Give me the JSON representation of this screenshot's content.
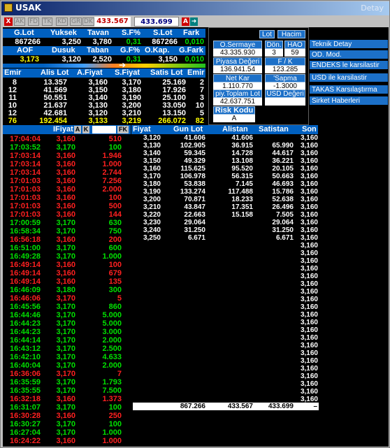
{
  "window": {
    "title": "USAK",
    "right_label": "Detay"
  },
  "toolbar": {
    "close": "X",
    "buttons": [
      "AK",
      "FD",
      "TK",
      "KD",
      "GR",
      "DK"
    ],
    "price_sell": "433.567",
    "price_buy": "433.699",
    "a_label": "A",
    "arrow": "➜"
  },
  "summary": {
    "headers1": [
      "G.Lot",
      "Yuksek",
      "Tavan",
      "S.F%",
      "S.Lot",
      "Fark"
    ],
    "values1": [
      "867266",
      "3,250",
      "3,780",
      "0,31",
      "867266",
      "0,010"
    ],
    "headers2": [
      "AOF",
      "Dusuk",
      "Taban",
      "G.F%",
      "O.Kap.",
      "G.Fark"
    ],
    "values2": [
      "3,173",
      "3,120",
      "2,520",
      "0,31",
      "3,150",
      "0,010"
    ]
  },
  "depth": {
    "headers": [
      "Emir",
      "Alis Lot",
      "A.Fiyat",
      "S.Fiyat",
      "Satis Lot",
      "Emir"
    ],
    "rows": [
      [
        "8",
        "13.357",
        "3,160",
        "3,170",
        "25.169",
        "2"
      ],
      [
        "12",
        "41.569",
        "3,150",
        "3,180",
        "17.926",
        "7"
      ],
      [
        "11",
        "50.551",
        "3,140",
        "3,190",
        "25.100",
        "3"
      ],
      [
        "10",
        "21.637",
        "3,130",
        "3,200",
        "33.050",
        "10"
      ],
      [
        "12",
        "42.681",
        "3,120",
        "3,210",
        "13.150",
        "5"
      ]
    ],
    "totals": [
      "76",
      "192.454",
      "3,133",
      "3,219",
      "266.072",
      "82"
    ]
  },
  "info_panel": {
    "lot_button": "Lot",
    "hacim_button": "Hacim",
    "o_sermaye_label": "O.Sermaye",
    "o_sermaye_value": "43.335.930",
    "don_label": "Dön.",
    "don_value": "3",
    "hao_label": "HAO",
    "hao_value": "59",
    "piyasa_label": "Piyasa Değeri",
    "piyasa_value": "136.941.54",
    "fk_label": "F / K",
    "fk_value": "123.285",
    "net_kar_label": "Net Kar",
    "net_kar_value": "1.110.770",
    "sapma_label": "'Sapma",
    "sapma_value": "-1.3000",
    "piy_toplam_label": "piy.Toplam Lot",
    "piy_toplam_value": "42.637.751",
    "usd_label": "USD Değeri",
    "usd_value": "",
    "risk_label": "Risk Kodu",
    "risk_value": "A"
  },
  "right_menu": [
    "Teknik Detay",
    "OD. Mod.",
    "ENDEKS le karsilastir",
    "USD ile karsilastir",
    "TAKAS Karsılaştırma",
    "Sirket Haberleri"
  ],
  "trades": {
    "headers": {
      "fiyat": "IFiyat",
      "a": "A",
      "k": "K",
      "fk": "FK"
    },
    "rows": [
      [
        "17:04:04",
        "3,160",
        "510",
        "r"
      ],
      [
        "17:03:52",
        "3,170",
        "100",
        "g"
      ],
      [
        "17:03:14",
        "3,160",
        "1.946",
        "r"
      ],
      [
        "17:03:14",
        "3,160",
        "1.000",
        "r"
      ],
      [
        "17:03:14",
        "3,160",
        "2.744",
        "r"
      ],
      [
        "17:01:03",
        "3,160",
        "7.256",
        "r"
      ],
      [
        "17:01:03",
        "3,160",
        "2.000",
        "r"
      ],
      [
        "17:01:03",
        "3,160",
        "100",
        "r"
      ],
      [
        "17:01:03",
        "3,160",
        "500",
        "r"
      ],
      [
        "17:01:03",
        "3,160",
        "144",
        "r"
      ],
      [
        "17:00:59",
        "3,170",
        "630",
        "g"
      ],
      [
        "16:58:34",
        "3,170",
        "750",
        "g"
      ],
      [
        "16:56:18",
        "3,160",
        "200",
        "r"
      ],
      [
        "16:51:00",
        "3,170",
        "600",
        "g"
      ],
      [
        "16:49:28",
        "3,170",
        "1.000",
        "g"
      ],
      [
        "16:49:14",
        "3,160",
        "100",
        "r"
      ],
      [
        "16:49:14",
        "3,160",
        "679",
        "r"
      ],
      [
        "16:49:14",
        "3,160",
        "135",
        "r"
      ],
      [
        "16:46:09",
        "3,180",
        "300",
        "g"
      ],
      [
        "16:46:06",
        "3,170",
        "5",
        "r"
      ],
      [
        "16:45:56",
        "3,170",
        "860",
        "g"
      ],
      [
        "16:44:46",
        "3,170",
        "5.000",
        "g"
      ],
      [
        "16:44:23",
        "3,170",
        "5.000",
        "g"
      ],
      [
        "16:44:23",
        "3,170",
        "3.000",
        "g"
      ],
      [
        "16:44:14",
        "3,170",
        "2.000",
        "g"
      ],
      [
        "16:43:12",
        "3,170",
        "2.500",
        "g"
      ],
      [
        "16:42:10",
        "3,170",
        "4.633",
        "g"
      ],
      [
        "16:40:04",
        "3,170",
        "2.000",
        "g"
      ],
      [
        "16:36:06",
        "3,170",
        "7",
        "r"
      ],
      [
        "16:35:59",
        "3,170",
        "1.793",
        "g"
      ],
      [
        "16:35:55",
        "3,170",
        "7.500",
        "g"
      ],
      [
        "16:32:18",
        "3,160",
        "1.373",
        "r"
      ],
      [
        "16:31:07",
        "3,170",
        "100",
        "g"
      ],
      [
        "16:30:28",
        "3,160",
        "250",
        "r"
      ],
      [
        "16:30:27",
        "3,170",
        "100",
        "g"
      ],
      [
        "16:27:04",
        "3,170",
        "1.000",
        "g"
      ],
      [
        "16:24:22",
        "3,160",
        "1.000",
        "r"
      ]
    ]
  },
  "dist": {
    "headers": [
      "Fiyat",
      "Gun Lot",
      "Alistan",
      "Satistan",
      "Son"
    ],
    "rows": [
      [
        "3,120",
        "41.606",
        "41.606",
        "",
        ""
      ],
      [
        "3,130",
        "102.905",
        "36.915",
        "65.990",
        ""
      ],
      [
        "3,140",
        "59.345",
        "14.728",
        "44.617",
        ""
      ],
      [
        "3,150",
        "49.329",
        "13.108",
        "36.221",
        ""
      ],
      [
        "3,160",
        "115.625",
        "95.520",
        "20.105",
        ""
      ],
      [
        "3,170",
        "106.978",
        "56.315",
        "50.663",
        ""
      ],
      [
        "3,180",
        "53.838",
        "7.145",
        "46.693",
        ""
      ],
      [
        "3,190",
        "133.274",
        "117.488",
        "15.786",
        ""
      ],
      [
        "3,200",
        "70.871",
        "18.233",
        "52.638",
        ""
      ],
      [
        "3,210",
        "43.847",
        "17.351",
        "26.496",
        ""
      ],
      [
        "3,220",
        "22.663",
        "15.158",
        "7.505",
        ""
      ],
      [
        "3,230",
        "29.064",
        "",
        "29.064",
        ""
      ],
      [
        "3,240",
        "31.250",
        "",
        "31.250",
        ""
      ],
      [
        "3,250",
        "6.671",
        "",
        "6.671",
        ""
      ]
    ],
    "son_values": [
      "3,160",
      "3,160",
      "3,160",
      "3,160",
      "3,160",
      "3,160",
      "3,160",
      "3,160",
      "3,160",
      "3,160",
      "3,160",
      "3,160",
      "3,160",
      "3,160",
      "3,160",
      "3,160",
      "3,160",
      "3,160",
      "3,160",
      "3,160",
      "3,160",
      "3,160",
      "3,160",
      "3,160",
      "3,160",
      "3,160",
      "3,160",
      "3,160",
      "3,160",
      "3,160",
      "3,160",
      "3,160",
      "3,160",
      "3,160",
      "3,160",
      "3,160",
      "3,160",
      "3,160",
      "3,160",
      "3,160",
      "3,160",
      "3,160",
      "3,160",
      "3,160",
      "3,160",
      "3,160",
      "3,160",
      "3,160",
      "3,160",
      "3,160",
      "3,160",
      "3,160",
      "3,160",
      "3,160",
      "3,160",
      "3,160",
      "3,160",
      "3,160",
      "3,160",
      "3,160",
      "3,160",
      "3,160",
      "3,160",
      "3,160",
      "3,160",
      "3,160",
      "3,160",
      "3,160",
      "3,160",
      "3,160",
      "3,160",
      "3,160",
      "3,160",
      "3,160",
      "3,160",
      "3,160",
      "3,160",
      "3,160",
      "3,160",
      "3,160",
      "3,160",
      "3,160",
      "3,160",
      "3,160",
      "3,160",
      "3,160",
      "3,160",
      "3,160",
      "3,160",
      "3,160",
      "3,160",
      "3,160",
      "3,160",
      "3,160",
      "3,160",
      "3,160",
      "3,160",
      "3,160",
      "3,160",
      "3,160",
      "3,160",
      "3,160",
      "3,160",
      "3,160"
    ],
    "totals": [
      "867.266",
      "433.567",
      "433.699",
      "–"
    ]
  }
}
